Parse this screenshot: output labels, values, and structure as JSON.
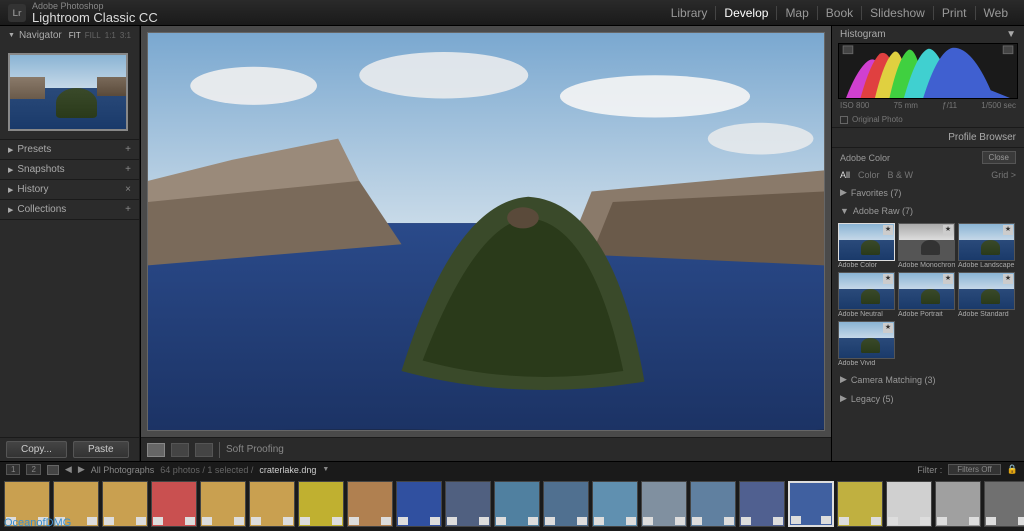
{
  "header": {
    "logo": "Lr",
    "subtitle": "Adobe Photoshop",
    "title": "Lightroom Classic CC",
    "modules": [
      "Library",
      "Develop",
      "Map",
      "Book",
      "Slideshow",
      "Print",
      "Web"
    ],
    "active_module": "Develop"
  },
  "left": {
    "navigator": {
      "label": "Navigator",
      "zoom": [
        "FIT",
        "FILL",
        "1:1",
        "3:1"
      ]
    },
    "sections": [
      "Presets",
      "Snapshots",
      "History",
      "Collections"
    ]
  },
  "toolbar": {
    "copy": "Copy...",
    "paste": "Paste",
    "soft_proof": "Soft Proofing"
  },
  "right": {
    "histogram": {
      "label": "Histogram",
      "iso": "ISO 800",
      "lens": "75 mm",
      "aperture": "ƒ/11",
      "shutter": "1/500 sec",
      "orig": "Original Photo"
    },
    "profile": {
      "title": "Profile Browser",
      "name": "Adobe Color",
      "close": "Close",
      "tabs": [
        "All",
        "Color",
        "B & W"
      ],
      "grid": "Grid",
      "favorites": "Favorites (7)",
      "raw": "Adobe Raw (7)",
      "items": [
        "Adobe Color",
        "Adobe Monochrome",
        "Adobe Landscape",
        "Adobe Neutral",
        "Adobe Portrait",
        "Adobe Standard",
        "Adobe Vivid"
      ],
      "camera_matching": "Camera Matching (3)",
      "legacy": "Legacy (5)"
    }
  },
  "filmstrip": {
    "badges": [
      "1",
      "2"
    ],
    "breadcrumb": "All Photographs",
    "count": "64 photos / 1 selected /",
    "file": "craterlake.dng",
    "filter": "Filter :",
    "filters_off": "Filters Off",
    "thumbs": 21,
    "selected": 16
  },
  "watermark": "OceanofDMG"
}
